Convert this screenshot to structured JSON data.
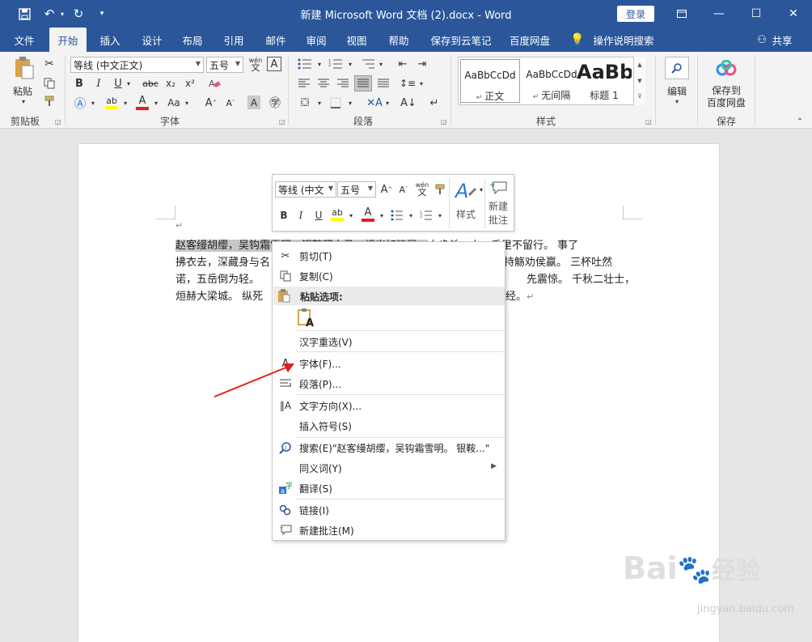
{
  "window": {
    "doc_title": "新建 Microsoft Word 文档 (2).docx - Word",
    "login_label": "登录"
  },
  "tabs": [
    "文件",
    "开始",
    "插入",
    "设计",
    "布局",
    "引用",
    "邮件",
    "审阅",
    "视图",
    "帮助",
    "保存到云笔记",
    "百度网盘",
    "操作说明搜索",
    "共享"
  ],
  "ribbon": {
    "clipboard": {
      "paste_label": "粘贴",
      "group_label": "剪贴板"
    },
    "font": {
      "font_name": "等线 (中文正文)",
      "font_size": "五号",
      "group_label": "字体",
      "phonetic": "wén",
      "phonetic_char": "文"
    },
    "paragraph": {
      "group_label": "段落"
    },
    "styles": {
      "group_label": "样式",
      "items": [
        {
          "preview": "AaBbCcDd",
          "name": "正文"
        },
        {
          "preview": "AaBbCcDd",
          "name": "无间隔"
        },
        {
          "preview": "AaBb",
          "name": "标题 1"
        }
      ]
    },
    "editing": {
      "label": "编辑"
    },
    "save": {
      "label_line1": "保存到",
      "label_line2": "百度网盘",
      "group_label": "保存"
    }
  },
  "document": {
    "lines": [
      {
        "selected": "赵客缦胡缨，吴钩霜雪明。银鞍照白马，飒沓如流星。",
        "rest": "十步杀一人，千里不留行。 事了"
      },
      {
        "left": "拂衣去，深藏身与名",
        "right": "持觞劝侯嬴。 三杯吐然"
      },
      {
        "left": "诺，五岳倒为轻。",
        "right": "先震惊。 千秋二壮士，"
      },
      {
        "left": "烜赫大梁城。 纵死",
        "right": "经。"
      }
    ],
    "mark": "↵"
  },
  "mini_toolbar": {
    "font_name": "等线 (中文",
    "font_size": "五号",
    "styles_label": "样式",
    "comment_line1": "新建",
    "comment_line2": "批注"
  },
  "context_menu": {
    "cut": "剪切(T)",
    "copy": "复制(C)",
    "paste_options": "粘贴选项:",
    "reconvert": "汉字重选(V)",
    "font": "字体(F)...",
    "paragraph": "段落(P)...",
    "text_direction": "文字方向(X)...",
    "insert_symbol": "插入符号(S)",
    "search": "搜索(E)\"赵客缦胡缨，吴钩霜雪明。 银鞍...\"",
    "synonyms": "同义词(Y)",
    "translate": "翻译(S)",
    "link": "链接(I)",
    "new_comment": "新建批注(M)"
  },
  "watermark": {
    "main": "Bai",
    "main2": "经验",
    "sub": "jingyan.baidu.com"
  },
  "colors": {
    "title_bar": "#2b579a",
    "arrow": "#e02020",
    "highlight_yellow": "#ffff00",
    "font_red": "#e02020"
  }
}
